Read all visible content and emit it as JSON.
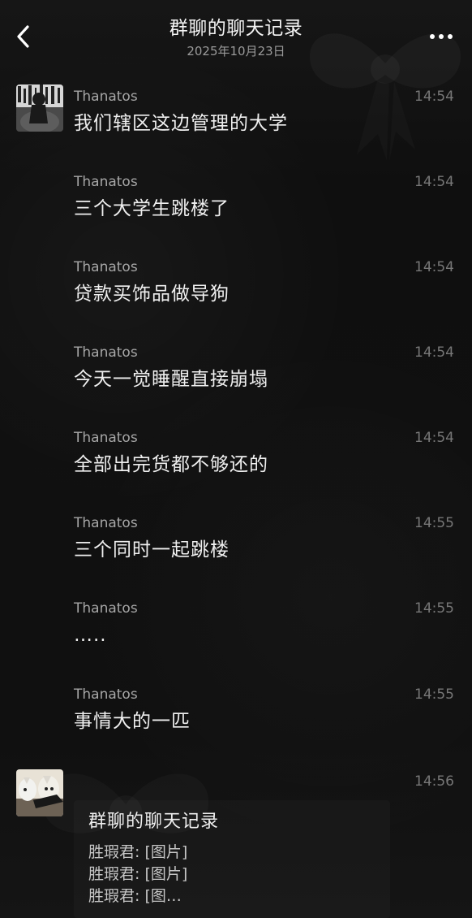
{
  "header": {
    "title": "群聊的聊天记录",
    "date": "2025年10月23日",
    "back_icon": "chevron-left-icon",
    "more_icon": "more-horizontal-icon"
  },
  "colors": {
    "background": "#0f0f0f",
    "text": "#efefef",
    "secondary_text": "#a6a6a6",
    "time_text": "#777777"
  },
  "messages": [
    {
      "sender": "Thanatos",
      "time": "14:54",
      "text": "我们辖区这边管理的大学"
    },
    {
      "sender": "Thanatos",
      "time": "14:54",
      "text": "三个大学生跳楼了"
    },
    {
      "sender": "Thanatos",
      "time": "14:54",
      "text": "贷款买饰品做导狗"
    },
    {
      "sender": "Thanatos",
      "time": "14:54",
      "text": "今天一觉睡醒直接崩塌"
    },
    {
      "sender": "Thanatos",
      "time": "14:54",
      "text": "全部出完货都不够还的"
    },
    {
      "sender": "Thanatos",
      "time": "14:55",
      "text": "三个同时一起跳楼"
    },
    {
      "sender": "Thanatos",
      "time": "14:55",
      "text": "….."
    },
    {
      "sender": "Thanatos",
      "time": "14:55",
      "text": "事情大的一匹"
    }
  ],
  "forwarded_record": {
    "time": "14:56",
    "title": "群聊的聊天记录",
    "lines": [
      "胜瑕君: [图片]",
      "胜瑕君: [图片]",
      "胜瑕君: [图…"
    ]
  }
}
